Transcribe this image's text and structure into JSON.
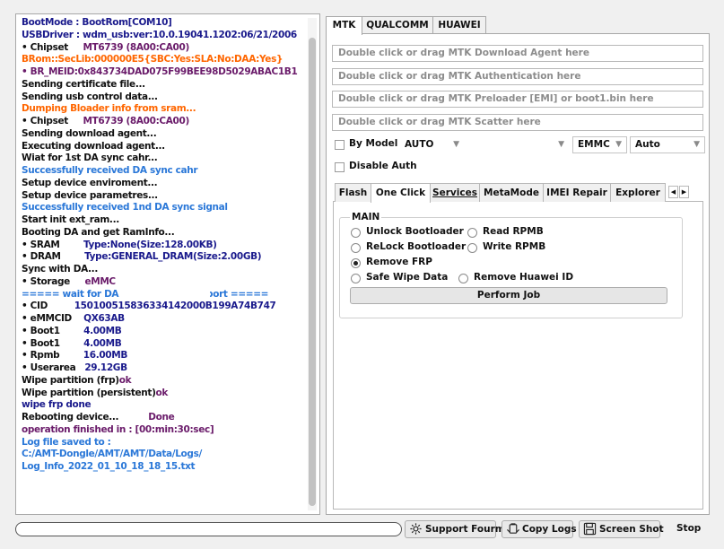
{
  "log": {
    "lines": [
      [
        {
          "text": "BootMode : ",
          "color": "#1a1a8c"
        },
        {
          "text": "BootRom[COM10]",
          "color": "#1a1a8c"
        }
      ],
      [
        {
          "text": "USBDriver : wdm_usb:ver:10.0.19041.1202:06/21/2006",
          "color": "#1a1a8c"
        }
      ],
      [
        {
          "text": "• Chipset     ",
          "color": "#111111"
        },
        {
          "text": "MT6739 (8A00:CA00)",
          "color": "#6a1b6a"
        }
      ],
      [
        {
          "text": "BRom::SecLib:000000E5{SBC:Yes:SLA:No:DAA:Yes}",
          "color": "#ff6600"
        }
      ],
      [
        {
          "text": "• BR_MEID:0x843734DAD075F99BEE98D5029ABAC1B1",
          "color": "#6a1b6a"
        }
      ],
      [
        {
          "text": "Sending certificate file...",
          "color": "#111111"
        }
      ],
      [
        {
          "text": "Sending usb control data...",
          "color": "#111111"
        }
      ],
      [
        {
          "text": "Dumping Bloader info from sram...",
          "color": "#ff6600"
        }
      ],
      [
        {
          "text": "• Chipset     ",
          "color": "#111111"
        },
        {
          "text": "MT6739 (8A00:CA00)",
          "color": "#6a1b6a"
        }
      ],
      [
        {
          "text": "Sending download agent...",
          "color": "#111111"
        }
      ],
      [
        {
          "text": "Executing download agent...",
          "color": "#111111"
        }
      ],
      [
        {
          "text": "Wiat for 1st DA sync cahr...",
          "color": "#111111"
        }
      ],
      [
        {
          "text": "Successfully received DA sync cahr",
          "color": "#2b78d8"
        }
      ],
      [
        {
          "text": "Setup device enviroment...",
          "color": "#111111"
        }
      ],
      [
        {
          "text": "Setup device parametres...",
          "color": "#111111"
        }
      ],
      [
        {
          "text": "Successfully received 1nd DA sync signal",
          "color": "#2b78d8"
        }
      ],
      [
        {
          "text": "Start init ext_ram...",
          "color": "#111111"
        }
      ],
      [
        {
          "text": "Booting DA and get RamInfo...",
          "color": "#111111"
        }
      ],
      [
        {
          "text": "• SRAM        ",
          "color": "#111111"
        },
        {
          "text": "Type:None(Size:128.00KB)",
          "color": "#1a1a8c"
        }
      ],
      [
        {
          "text": "• DRAM        ",
          "color": "#111111"
        },
        {
          "text": "Type:GENERAL_DRAM(Size:2.00GB)",
          "color": "#1a1a8c"
        }
      ],
      [
        {
          "text": "Sync with DA...",
          "color": "#111111"
        }
      ],
      [
        {
          "text": "• Storage     ",
          "color": "#111111"
        },
        {
          "text": "eMMC",
          "color": "#6a1b6a"
        }
      ],
      [
        {
          "text": "===== wait for DA H/W detection report =====",
          "color": "#2b78d8"
        }
      ],
      [
        {
          "text": "• CID         ",
          "color": "#111111"
        },
        {
          "text": "150100515836334142000B199A74B747",
          "color": "#1a1a8c"
        }
      ],
      [
        {
          "text": "• eMMCID    ",
          "color": "#111111"
        },
        {
          "text": "QX63AB",
          "color": "#1a1a8c"
        }
      ],
      [
        {
          "text": "• Boot1        ",
          "color": "#111111"
        },
        {
          "text": "4.00MB",
          "color": "#1a1a8c"
        }
      ],
      [
        {
          "text": "• Boot1        ",
          "color": "#111111"
        },
        {
          "text": "4.00MB",
          "color": "#1a1a8c"
        }
      ],
      [
        {
          "text": "• Rpmb        ",
          "color": "#111111"
        },
        {
          "text": "16.00MB",
          "color": "#1a1a8c"
        }
      ],
      [
        {
          "text": "• Userarea   ",
          "color": "#111111"
        },
        {
          "text": "29.12GB",
          "color": "#1a1a8c"
        }
      ],
      [
        {
          "text": "Wipe partition (frp)",
          "color": "#111111"
        },
        {
          "text": "ok",
          "color": "#6a1b6a"
        }
      ],
      [
        {
          "text": "Wipe partition (persistent)",
          "color": "#111111"
        },
        {
          "text": "ok",
          "color": "#6a1b6a"
        }
      ],
      [
        {
          "text": "wipe frp done",
          "color": "#1a1a8c"
        }
      ],
      [
        {
          "text": "Rebooting device...          ",
          "color": "#111111"
        },
        {
          "text": "Done",
          "color": "#6a1b6a"
        }
      ],
      [
        {
          "text": "operation finished in : [00:min:30:sec]",
          "color": "#6a1b6a"
        }
      ],
      [
        {
          "text": "Log file saved to :",
          "color": "#2b78d8"
        }
      ],
      [
        {
          "text": "C:/AMT-Dongle/AMT/AMT/Data/Logs/",
          "color": "#2b78d8"
        }
      ],
      [
        {
          "text": "Log_Info_2022_01_10_18_18_15.txt",
          "color": "#2b78d8"
        }
      ]
    ]
  },
  "top_tabs": [
    {
      "label": "MTK",
      "active": true
    },
    {
      "label": "QUALCOMM",
      "active": false
    },
    {
      "label": "HUAWEI",
      "active": false
    }
  ],
  "fields": {
    "download_agent": "Double click or drag MTK Download Agent here",
    "authentication": "Double click or drag MTK Authentication here",
    "preloader": "Double click or drag MTK Preloader [EMI] or boot1.bin here",
    "scatter": "Double click or drag MTK Scatter here"
  },
  "options": {
    "by_model_label": "By Model",
    "model_value": "AUTO",
    "storage_value": "EMMC",
    "mode_value": "Auto",
    "disable_auth_label": "Disable Auth"
  },
  "sub_tabs": [
    "Flash",
    "One Click",
    "Services",
    "MetaMode",
    "IMEI Repair",
    "Explorer"
  ],
  "main_group": {
    "legend": "MAIN",
    "unlock_bootloader": "Unlock Bootloader",
    "read_rpmb": "Read RPMB",
    "relock_bootloader": "ReLock Bootloader",
    "write_rpmb": "Write RPMB",
    "remove_frp": "Remove FRP",
    "safe_wipe_data": "Safe Wipe Data",
    "remove_huawei_id": "Remove Huawei ID",
    "perform_job": "Perform Job"
  },
  "bottom": {
    "progress_fraction": 0.0,
    "support_forum": "Support Fourm",
    "copy_logs": "Copy Logs",
    "screen_shot": "Screen Shot",
    "stop": "Stop"
  },
  "colors": {
    "accent_blue": "#2b78d8",
    "orange": "#ff6600",
    "purple": "#6a1b6a",
    "navy": "#1a1a8c"
  },
  "icons": {
    "support": "gear-icon",
    "copy": "copy-icon",
    "screenshot": "save-icon",
    "arrow": "chevron-down-icon"
  }
}
